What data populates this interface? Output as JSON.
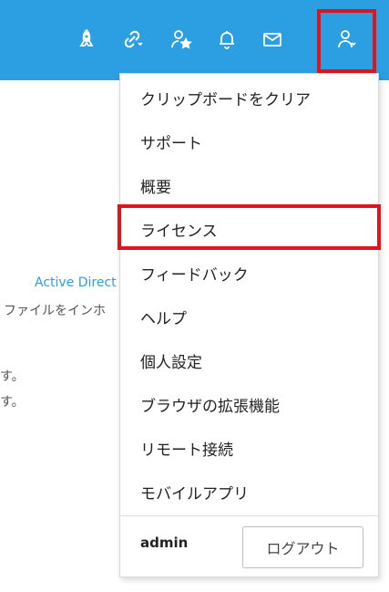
{
  "toolbar": {
    "icons": [
      "rocket-icon",
      "link-dropdown-icon",
      "user-star-icon",
      "bell-icon",
      "mail-icon",
      "user-menu-icon"
    ]
  },
  "background": {
    "line1": "Active Direct",
    "line2": "ファイルをインホ",
    "line3": "す。",
    "line4": "す。"
  },
  "menu": {
    "items": [
      "クリップボードをクリア",
      "サポート",
      "概要",
      "ライセンス",
      "フィードバック",
      "ヘルプ",
      "個人設定",
      "ブラウザの拡張機能",
      "リモート接続",
      "モバイルアプリ"
    ],
    "user_name": "admin",
    "logout_label": "ログアウト"
  },
  "colors": {
    "topbar": "#2b9fe2",
    "highlight": "#e0141c"
  }
}
